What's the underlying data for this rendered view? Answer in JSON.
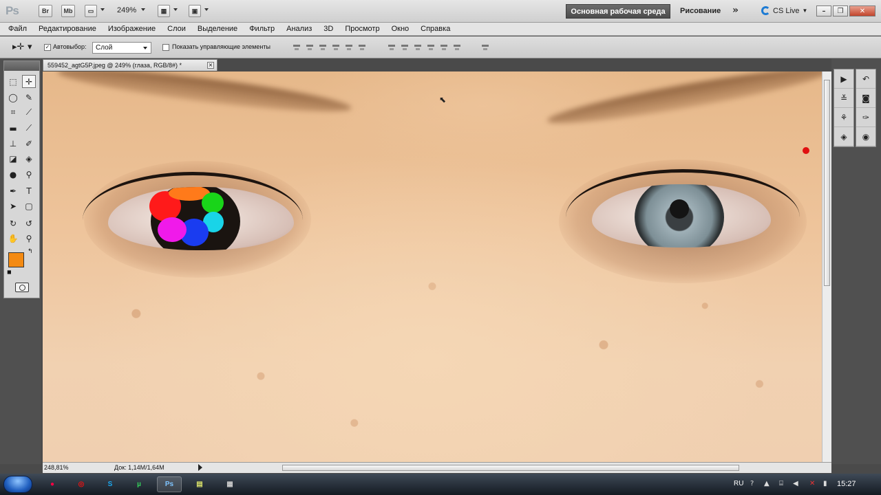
{
  "app": {
    "logo": "Ps",
    "bridge_label": "Br",
    "minibridge_label": "Mb",
    "zoom": "249%",
    "workspace_active": "Основная рабочая среда",
    "workspace_inactive": "Рисование",
    "cs_live": "CS Live"
  },
  "menu": [
    "Файл",
    "Редактирование",
    "Изображение",
    "Слои",
    "Выделение",
    "Фильтр",
    "Анализ",
    "3D",
    "Просмотр",
    "Окно",
    "Справка"
  ],
  "options": {
    "autoselect_label": "Автовыбор:",
    "autoselect_value": "Слой",
    "show_controls_label": "Показать управляющие элементы"
  },
  "document": {
    "tab_title": "559452_agtG5P.jpeg @ 249% (глаза, RGB/8#) *",
    "close_glyph": "×"
  },
  "status": {
    "zoom": "248,81%",
    "doc_size": "Док: 1,14M/1,64M"
  },
  "colors": {
    "foreground": "#f48a12",
    "background": "#ffffff",
    "brush_red": "#ff1a1a",
    "brush_orange": "#ff7a1a",
    "brush_green": "#19d419",
    "brush_cyan": "#19d4e8",
    "brush_blue": "#1a3cf0",
    "brush_magenta": "#f01aea"
  },
  "taskbar": {
    "tray_lang": "RU",
    "clock": "15:27"
  }
}
